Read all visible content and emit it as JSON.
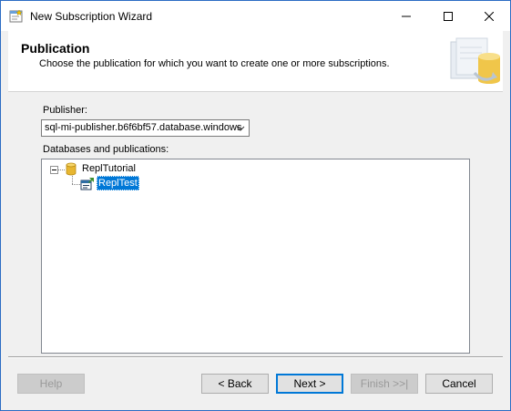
{
  "window": {
    "title": "New Subscription Wizard"
  },
  "header": {
    "title": "Publication",
    "subtitle": "Choose the publication for which you want to create one or more subscriptions."
  },
  "publisher": {
    "label": "Publisher:",
    "value": "sql-mi-publisher.b6f6bf57.database.windows"
  },
  "tree": {
    "label": "Databases and publications:",
    "database": {
      "name": "ReplTutorial",
      "icon": "database-icon",
      "expanded": true
    },
    "publication": {
      "name": "ReplTest",
      "icon": "publication-icon",
      "selected": true
    }
  },
  "buttons": {
    "help": "Help",
    "back": "< Back",
    "next": "Next >",
    "finish": "Finish >>|",
    "cancel": "Cancel"
  },
  "colors": {
    "selection": "#0078d7",
    "window_border": "#2b6cc4",
    "dialog_background": "#f0f0f0"
  }
}
